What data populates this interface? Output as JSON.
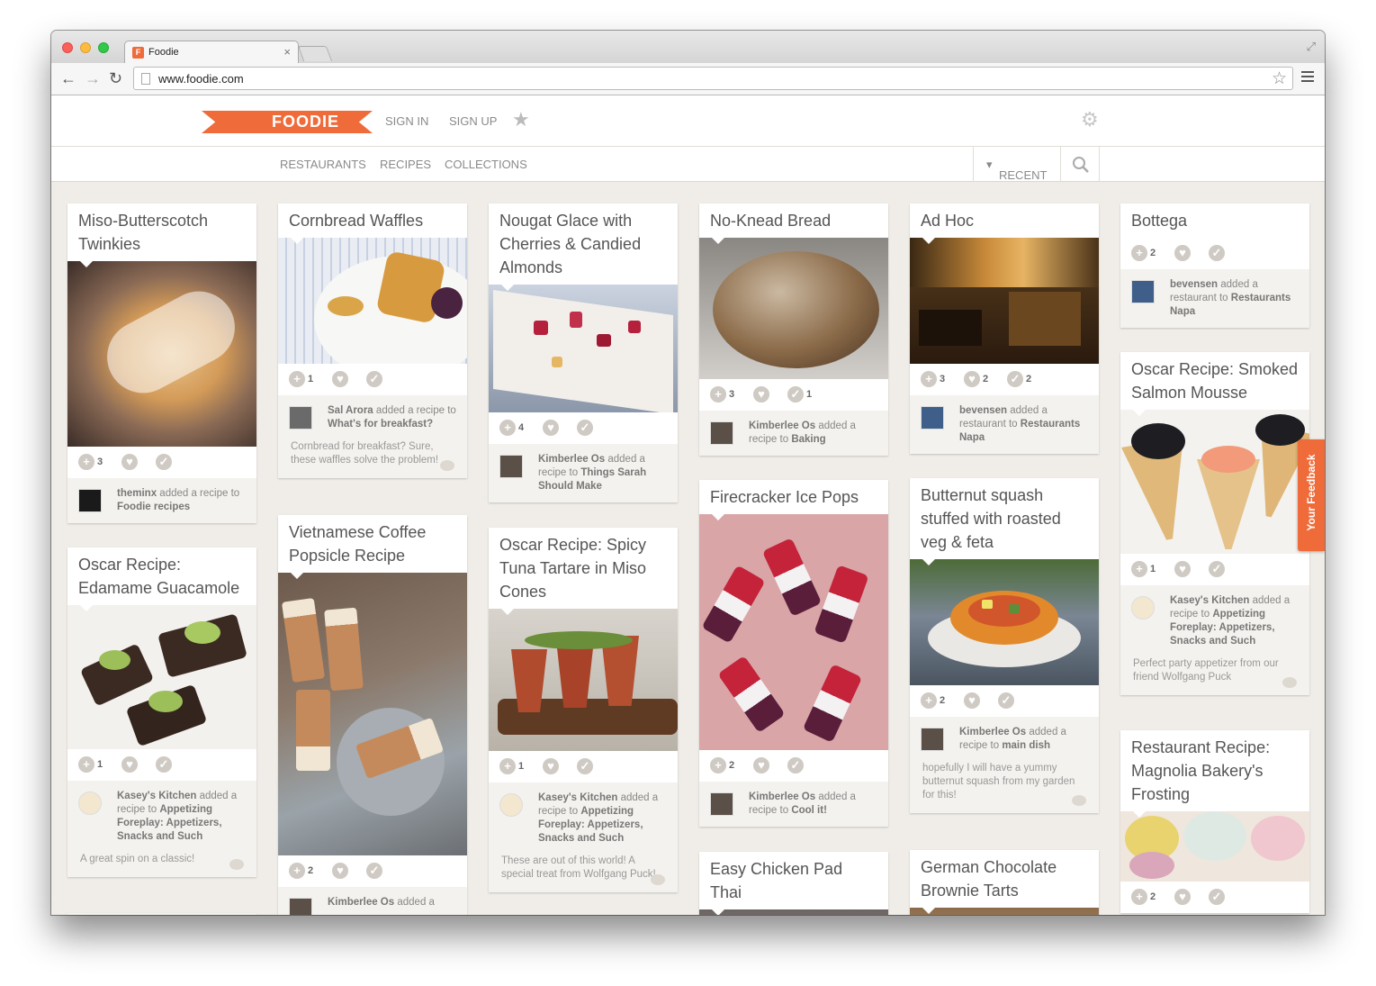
{
  "browser": {
    "tab_title": "Foodie",
    "tab_favicon": "F",
    "url": "www.foodie.com"
  },
  "header": {
    "logo": "FOODIE",
    "sign_in": "SIGN IN",
    "sign_up": "SIGN UP"
  },
  "subnav": {
    "restaurants": "RESTAURANTS",
    "recipes": "RECIPES",
    "collections": "COLLECTIONS",
    "sort": "RECENT"
  },
  "feedback": "Your Feedback",
  "colors": {
    "accent": "#ef6b3a",
    "background": "#f0ede8",
    "text": "#555555"
  },
  "cards": [
    {
      "title": "Miso-Butterscotch Twinkies",
      "photo": "twinkie",
      "counts": [
        "3",
        "",
        ""
      ],
      "user": "theminx",
      "action": "added a recipe to",
      "target": "Foodie recipes",
      "comment": ""
    },
    {
      "title": "Oscar Recipe: Edamame Guacamole",
      "photo": "guacamole",
      "counts": [
        "1",
        "",
        ""
      ],
      "user": "Kasey's Kitchen",
      "action": "added a recipe to",
      "target": "Appetizing Foreplay: Appetizers, Snacks and Such",
      "comment": "A great spin on a classic!"
    },
    {
      "title": "Cornbread Waffles",
      "photo": "waffle",
      "counts": [
        "1",
        "",
        ""
      ],
      "user": "Sal Arora",
      "action": "added a recipe to",
      "target": "What's for breakfast?",
      "comment": "Cornbread for breakfast? Sure, these waffles solve the problem!"
    },
    {
      "title": "Vietnamese Coffee Popsicle Recipe",
      "photo": "coffeepops",
      "counts": [
        "2",
        "",
        ""
      ],
      "user": "Kimberlee Os",
      "action": "added a",
      "target": "",
      "comment": ""
    },
    {
      "title": "Nougat Glace with Cherries & Candied Almonds",
      "photo": "nougat",
      "counts": [
        "4",
        "",
        ""
      ],
      "user": "Kimberlee Os",
      "action": "added a recipe to",
      "target": "Things Sarah Should Make",
      "comment": ""
    },
    {
      "title": "Oscar Recipe: Spicy Tuna Tartare in Miso Cones",
      "photo": "tartare",
      "counts": [
        "1",
        "",
        ""
      ],
      "user": "Kasey's Kitchen",
      "action": "added a recipe to",
      "target": "Appetizing Foreplay: Appetizers, Snacks and Such",
      "comment": "These are out of this world! A special treat from Wolfgang Puck!"
    },
    {
      "title": "No-Knead Bread",
      "photo": "bread",
      "counts": [
        "3",
        "",
        "1"
      ],
      "user": "Kimberlee Os",
      "action": "added a recipe to",
      "target": "Baking",
      "comment": ""
    },
    {
      "title": "Firecracker Ice Pops",
      "photo": "icepops",
      "counts": [
        "2",
        "",
        ""
      ],
      "user": "Kimberlee Os",
      "action": "added a recipe to",
      "target": "Cool it!",
      "comment": ""
    },
    {
      "title": "Easy Chicken Pad Thai",
      "photo": "padthai",
      "counts": [
        "",
        "",
        ""
      ],
      "user": "",
      "action": "",
      "target": "",
      "comment": ""
    },
    {
      "title": "Ad Hoc",
      "photo": "restaurant",
      "counts": [
        "3",
        "2",
        "2"
      ],
      "user": "bevensen",
      "action": "added a restaurant to",
      "target": "Restaurants Napa",
      "comment": ""
    },
    {
      "title": "Butternut squash stuffed with roasted veg & feta",
      "photo": "squash",
      "counts": [
        "2",
        "",
        ""
      ],
      "user": "Kimberlee Os",
      "action": "added a recipe to",
      "target": "main dish",
      "comment": "hopefully I will have a yummy butternut squash from my garden for this!"
    },
    {
      "title": "German Chocolate Brownie Tarts",
      "photo": "brownie",
      "counts": [
        "",
        "",
        ""
      ],
      "user": "",
      "action": "",
      "target": "",
      "comment": ""
    },
    {
      "title": "Bottega",
      "photo": "",
      "counts": [
        "2",
        "",
        ""
      ],
      "user": "bevensen",
      "action": "added a restaurant to",
      "target": "Restaurants Napa",
      "comment": ""
    },
    {
      "title": "Oscar Recipe: Smoked Salmon Mousse",
      "photo": "salmon",
      "counts": [
        "1",
        "",
        ""
      ],
      "user": "Kasey's Kitchen",
      "action": "added a recipe to",
      "target": "Appetizing Foreplay: Appetizers, Snacks and Such",
      "comment": "Perfect party appetizer from our friend Wolfgang Puck"
    },
    {
      "title": "Restaurant Recipe: Magnolia Bakery's Frosting",
      "photo": "cupcakes",
      "counts": [
        "2",
        "",
        ""
      ],
      "user": "",
      "action": "",
      "target": "",
      "comment": ""
    }
  ]
}
